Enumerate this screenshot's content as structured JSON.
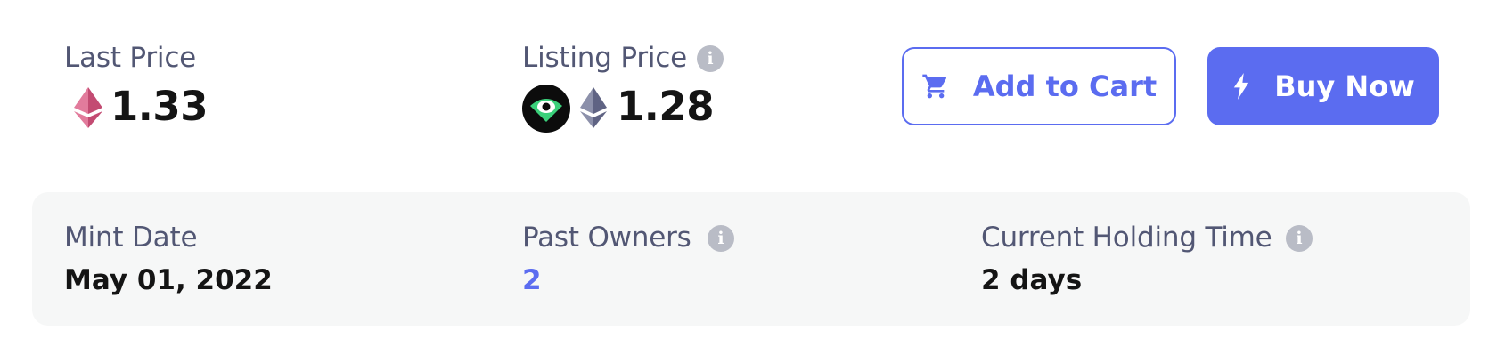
{
  "last_price": {
    "label": "Last Price",
    "value": "1.33",
    "currency_icon": "eth-icon",
    "currency_color": "#d9577f"
  },
  "listing_price": {
    "label": "Listing Price",
    "value": "1.28",
    "marketplace_icon": "eye-icon",
    "currency_icon": "eth-icon",
    "currency_color": "#6a6f8f"
  },
  "actions": {
    "add_to_cart_label": "Add to Cart",
    "add_to_cart_icon": "cart-icon",
    "buy_now_label": "Buy Now",
    "buy_now_icon": "lightning-icon"
  },
  "stats": {
    "mint_date": {
      "label": "Mint Date",
      "value": "May 01, 2022"
    },
    "past_owners": {
      "label": "Past Owners",
      "value": "2"
    },
    "holding_time": {
      "label": "Current Holding Time",
      "value": "2 days"
    }
  },
  "colors": {
    "accent": "#5b6cf0",
    "text_primary": "#141414",
    "text_label": "#525774",
    "info_icon": "#b9bcc6",
    "panel_bg": "#f6f7f7"
  }
}
